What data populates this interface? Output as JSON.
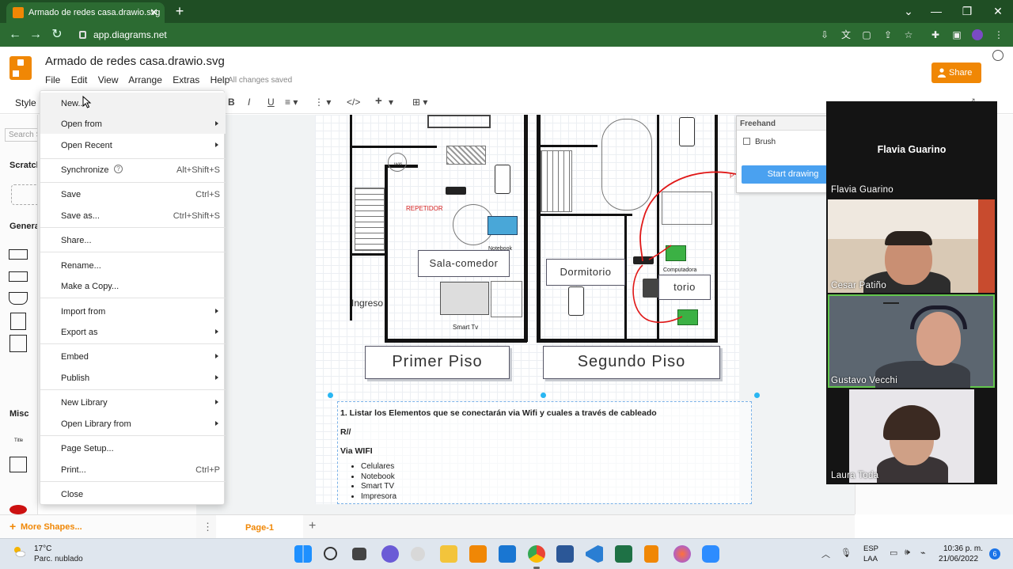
{
  "browser": {
    "tab_title": "Armado de redes casa.drawio.svg",
    "tab_close": "✕",
    "new_tab": "+",
    "url": "app.diagrams.net",
    "window_controls": [
      "⌄",
      "—",
      "❐",
      "✕"
    ]
  },
  "app": {
    "doc_title": "Armado de redes casa.drawio.svg",
    "menus": [
      "File",
      "Edit",
      "View",
      "Arrange",
      "Extras",
      "Help"
    ],
    "save_status": "All changes saved",
    "share_label": "Share",
    "accent_color": "#f08705"
  },
  "toolbar": {
    "style_label": "Style",
    "bold": "B",
    "italic": "I",
    "underline": "U",
    "html_code": "</>",
    "insert": "+"
  },
  "sidebar": {
    "search_placeholder": "Search S",
    "scratchpad": "Scratchp",
    "general": "General",
    "misc": "Misc",
    "title_shape": "Title",
    "more_shapes": "More Shapes..."
  },
  "file_menu": {
    "items": [
      {
        "label": "New...",
        "shortcut": "",
        "submenu": false
      },
      {
        "label": "Open from",
        "shortcut": "",
        "submenu": true
      },
      {
        "label": "Open Recent",
        "shortcut": "",
        "submenu": true
      },
      {
        "label": "Synchronize",
        "shortcut": "Alt+Shift+S",
        "submenu": false
      },
      {
        "label": "Save",
        "shortcut": "Ctrl+S",
        "submenu": false
      },
      {
        "label": "Save as...",
        "shortcut": "Ctrl+Shift+S",
        "submenu": false
      },
      {
        "label": "Share...",
        "shortcut": "",
        "submenu": false
      },
      {
        "label": "Rename...",
        "shortcut": "",
        "submenu": false
      },
      {
        "label": "Make a Copy...",
        "shortcut": "",
        "submenu": false
      },
      {
        "label": "Import from",
        "shortcut": "",
        "submenu": true
      },
      {
        "label": "Export as",
        "shortcut": "",
        "submenu": true
      },
      {
        "label": "Embed",
        "shortcut": "",
        "submenu": true
      },
      {
        "label": "Publish",
        "shortcut": "",
        "submenu": true
      },
      {
        "label": "New Library",
        "shortcut": "",
        "submenu": true
      },
      {
        "label": "Open Library from",
        "shortcut": "",
        "submenu": true
      },
      {
        "label": "Page Setup...",
        "shortcut": "",
        "submenu": false
      },
      {
        "label": "Print...",
        "shortcut": "Ctrl+P",
        "submenu": false
      },
      {
        "label": "Close",
        "shortcut": "",
        "submenu": false
      }
    ],
    "help_glyph": "?"
  },
  "diagram": {
    "repetidor": "REPETIDOR",
    "notebook": "Notebook",
    "sala_comedor": "Sala-comedor",
    "ingreso": "Ingreso",
    "smart_tv": "Smart Tv",
    "dormitorio": "Dormitorio",
    "dormitorio2": "torio",
    "computadora": "Computadora",
    "wifi_mark": "Wifi",
    "primer_piso": "Primer Piso",
    "segundo_piso": "Segundo Piso",
    "right_red_mark": "P"
  },
  "textblock": {
    "question": "1. Listar los Elementos que se conectarán via Wifi y cuales a través de cableado",
    "answer": "R//",
    "wifi_heading": "Via WIFI",
    "wifi_items": [
      "Celulares",
      "Notebook",
      "Smart TV",
      "Impresora"
    ]
  },
  "freehand": {
    "title": "Freehand",
    "brush": "Brush",
    "start": "Start drawing"
  },
  "pages": {
    "active_tab": "Page-1",
    "add": "+",
    "menu": "⋮"
  },
  "call": {
    "presenter": "Flavia Guarino",
    "participants": [
      "Flavia Guarino",
      "Cesar Patiño",
      "Gustavo Vecchi",
      "Laura Toda"
    ],
    "active_speaker_color": "#63c74d"
  },
  "taskbar": {
    "temperature": "17°C",
    "weather": "Parc. nublado",
    "lang1": "ESP",
    "lang2": "LAA",
    "time": "10:36 p. m.",
    "date": "21/06/2022",
    "notifications": "6"
  }
}
